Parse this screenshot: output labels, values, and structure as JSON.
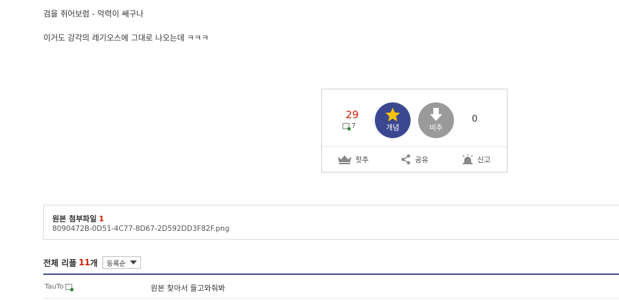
{
  "post": {
    "line1": "검을 쥐어보렴 - 악력이 쌔구나",
    "line2": "이거도 강각의 레기오스에 그대로 나오는데 ㅋㅋㅋ"
  },
  "vote": {
    "up_count": "29",
    "fixed_count": "7",
    "concept_label": "개념",
    "nonconcept_label": "비추",
    "down_count": "0",
    "actions": {
      "hit": "힛추",
      "share": "공유",
      "report": "신고"
    },
    "colors": {
      "concept": "#3b4890",
      "nonconcept": "#9a9a9a",
      "up_count": "#d31900",
      "star": "#ffc400"
    }
  },
  "attachment": {
    "title": "원본 첨부파일",
    "count": "1",
    "filename": "8090472B-0D51-4C77-8D67-2D592DD3F82F.png"
  },
  "comments": {
    "title": "전체 리플",
    "count": "11",
    "unit": "개",
    "sort_label": "등록순",
    "items": [
      {
        "author": "TauTo",
        "text": "원본 찾아서 들고와줘봐"
      }
    ]
  }
}
